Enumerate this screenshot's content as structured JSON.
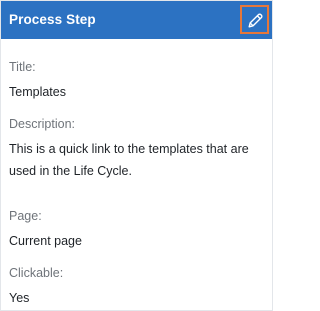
{
  "header": {
    "title": "Process Step",
    "edit_icon": "pencil-icon",
    "colors": {
      "header_bg": "#2c72c2",
      "edit_border": "#e6773a"
    }
  },
  "fields": {
    "title": {
      "label": "Title:",
      "value": "Templates"
    },
    "description": {
      "label": "Description:",
      "value": "This is a quick link to the templates that are used in the Life Cycle."
    },
    "page": {
      "label": "Page:",
      "value": "Current page"
    },
    "clickable": {
      "label": "Clickable:",
      "value": "Yes"
    }
  }
}
